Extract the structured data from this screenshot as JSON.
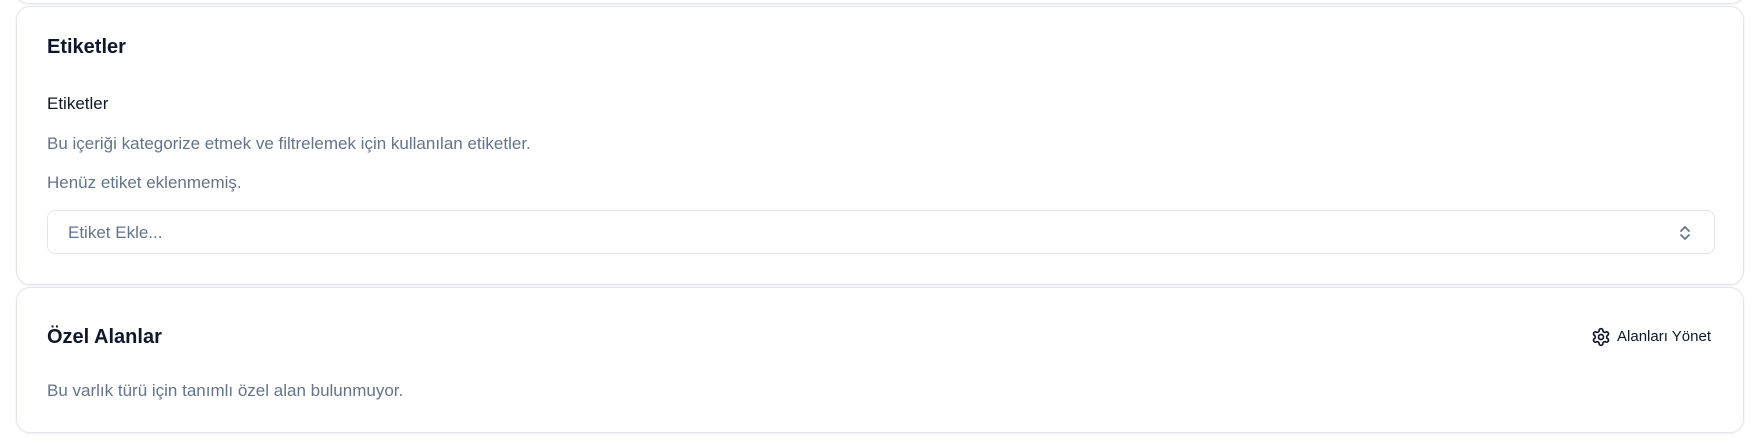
{
  "tags_section": {
    "title": "Etiketler",
    "field_label": "Etiketler",
    "description": "Bu içeriği kategorize etmek ve filtrelemek için kullanılan etiketler.",
    "empty_state": "Henüz etiket eklenmemiş.",
    "select": {
      "placeholder": "Etiket Ekle...",
      "icon": "chevrons-up-down-icon"
    }
  },
  "custom_fields_section": {
    "title": "Özel Alanlar",
    "manage_button": {
      "label": "Alanları Yönet",
      "icon": "gear-icon"
    },
    "empty_state": "Bu varlık türü için tanımlı özel alan bulunmuyor."
  },
  "colors": {
    "card_border": "#e2e5ea",
    "title_text": "#0f172a",
    "muted_text": "#64748b",
    "background": "#ffffff"
  }
}
